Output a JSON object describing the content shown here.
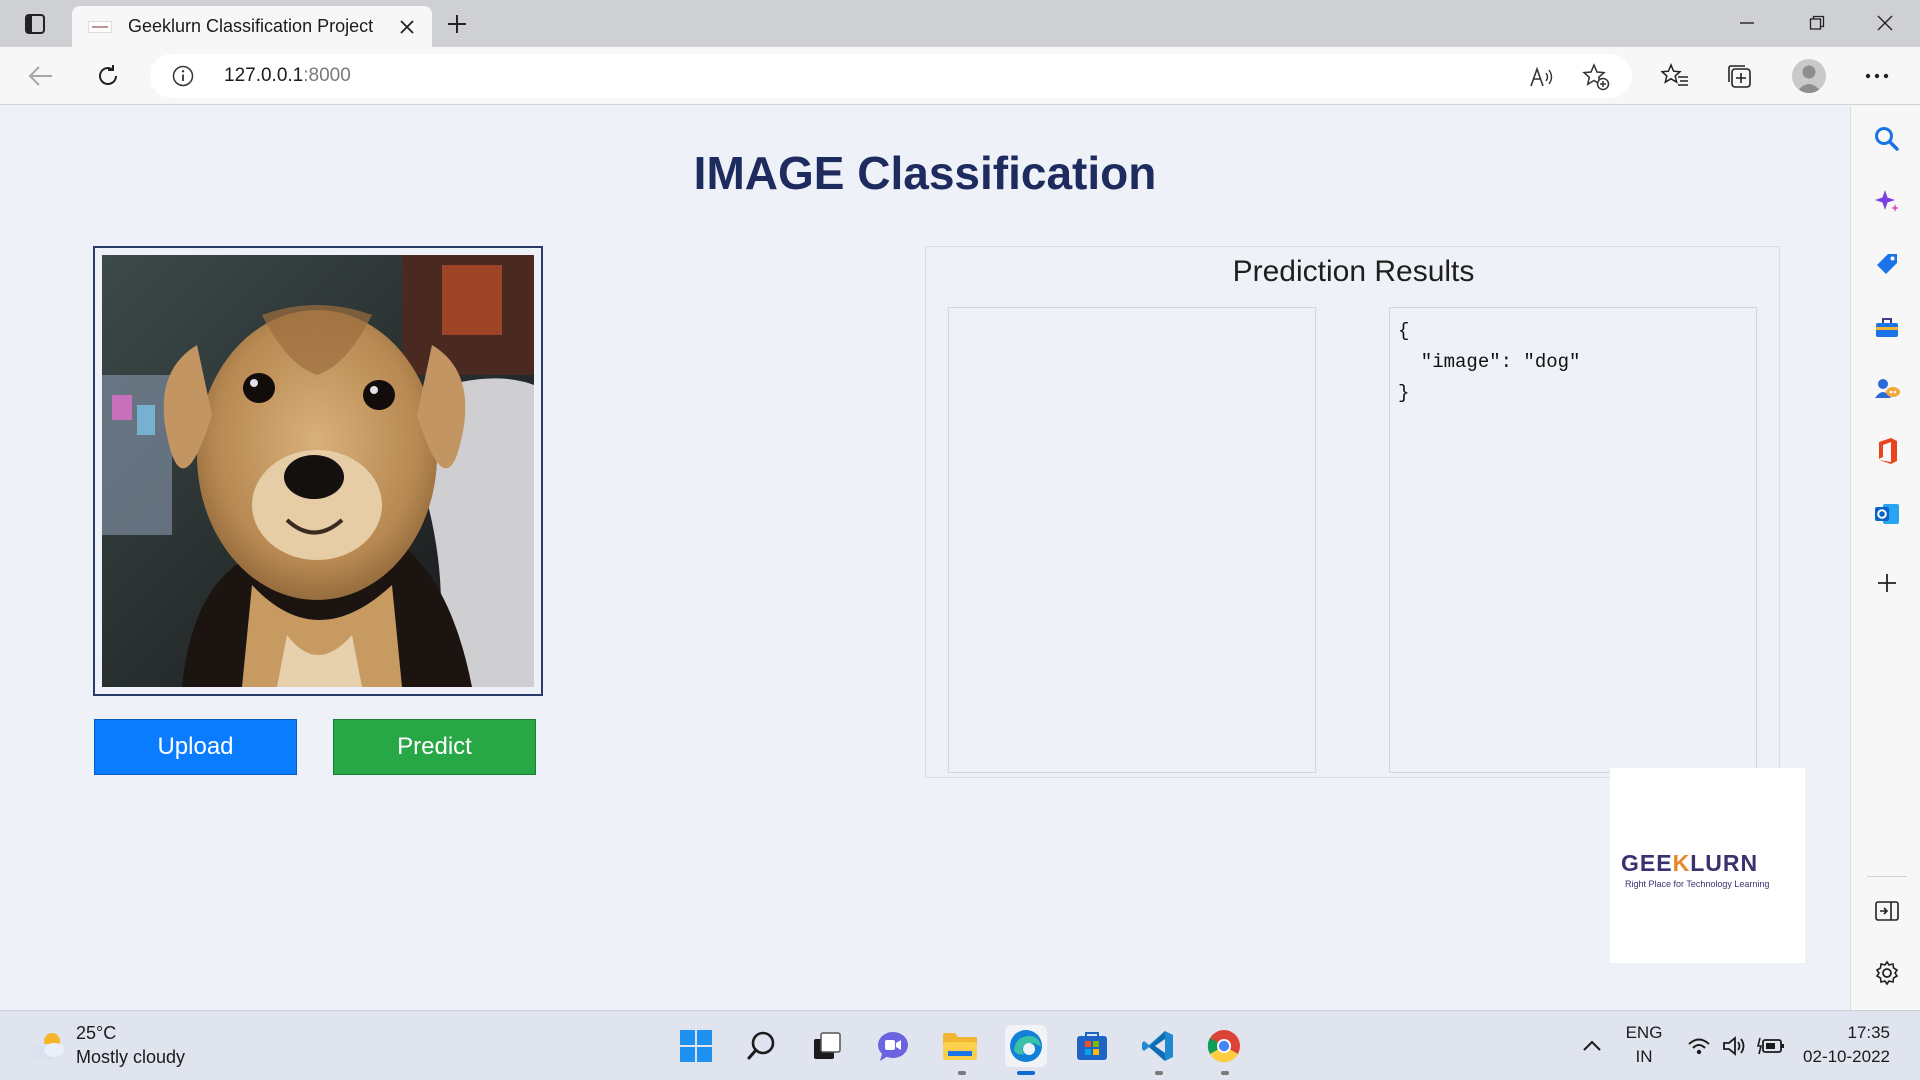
{
  "browser": {
    "tab_title": "Geeklurn Classification Project",
    "address": {
      "host": "127.0.0.1",
      "port": ":8000"
    }
  },
  "page": {
    "title": "IMAGE Classification",
    "upload_label": "Upload",
    "predict_label": "Predict",
    "results_title": "Prediction Results",
    "json_output": [
      "{",
      "  \"image\": \"dog\"",
      "}"
    ],
    "logo": {
      "word_left": "GEE",
      "word_k": "K",
      "word_right": "LURN",
      "tagline": "Right Place for Technology Learning"
    }
  },
  "taskbar": {
    "weather_temp": "25°C",
    "weather_desc": "Mostly cloudy",
    "lang_top": "ENG",
    "lang_bottom": "IN",
    "time": "17:35",
    "date": "02-10-2022"
  },
  "colors": {
    "upload_button": "#0a7cff",
    "predict_button": "#27a745",
    "title": "#1d2b5e",
    "page_background": "#eef1f8"
  },
  "icons": {
    "sidebar": [
      "search-icon",
      "sparkle-icon",
      "tag-icon",
      "toolbox-icon",
      "games-icon",
      "office-icon",
      "outlook-icon",
      "add-icon",
      "split-screen-icon",
      "settings-icon"
    ],
    "taskbar": [
      "start-icon",
      "search-icon",
      "task-view-icon",
      "chat-icon",
      "file-explorer-icon",
      "edge-icon",
      "store-icon",
      "vscode-icon",
      "chrome-icon"
    ]
  }
}
